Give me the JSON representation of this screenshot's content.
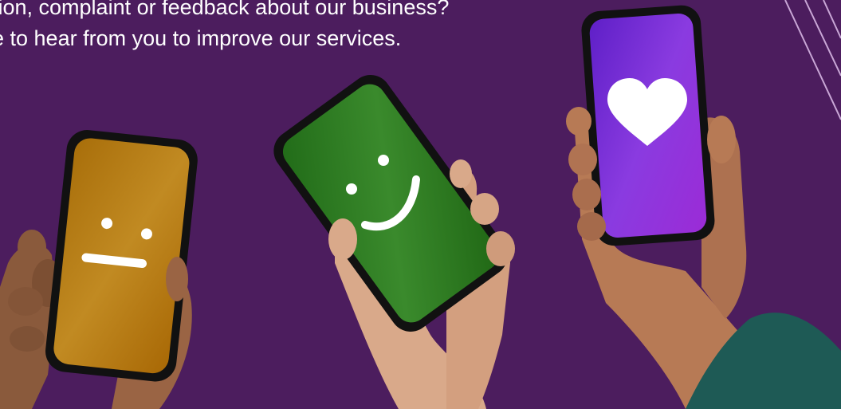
{
  "headline": {
    "line1": "tion, complaint or feedback about our business?",
    "line2": "e to hear from you to improve our services."
  },
  "phones": [
    {
      "mood": "neutral-face",
      "screen_color": "#b67a10"
    },
    {
      "mood": "smiley-face",
      "screen_color": "#2f7d22"
    },
    {
      "mood": "heart",
      "screen_color": "#8b2fd6"
    }
  ],
  "colors": {
    "background": "#4c1d5e",
    "text": "#ffffff",
    "skin_dark": "#8a5a3c",
    "skin_light": "#d9a98a",
    "skin_mid": "#b77a55",
    "sleeve": "#1e5a55"
  }
}
